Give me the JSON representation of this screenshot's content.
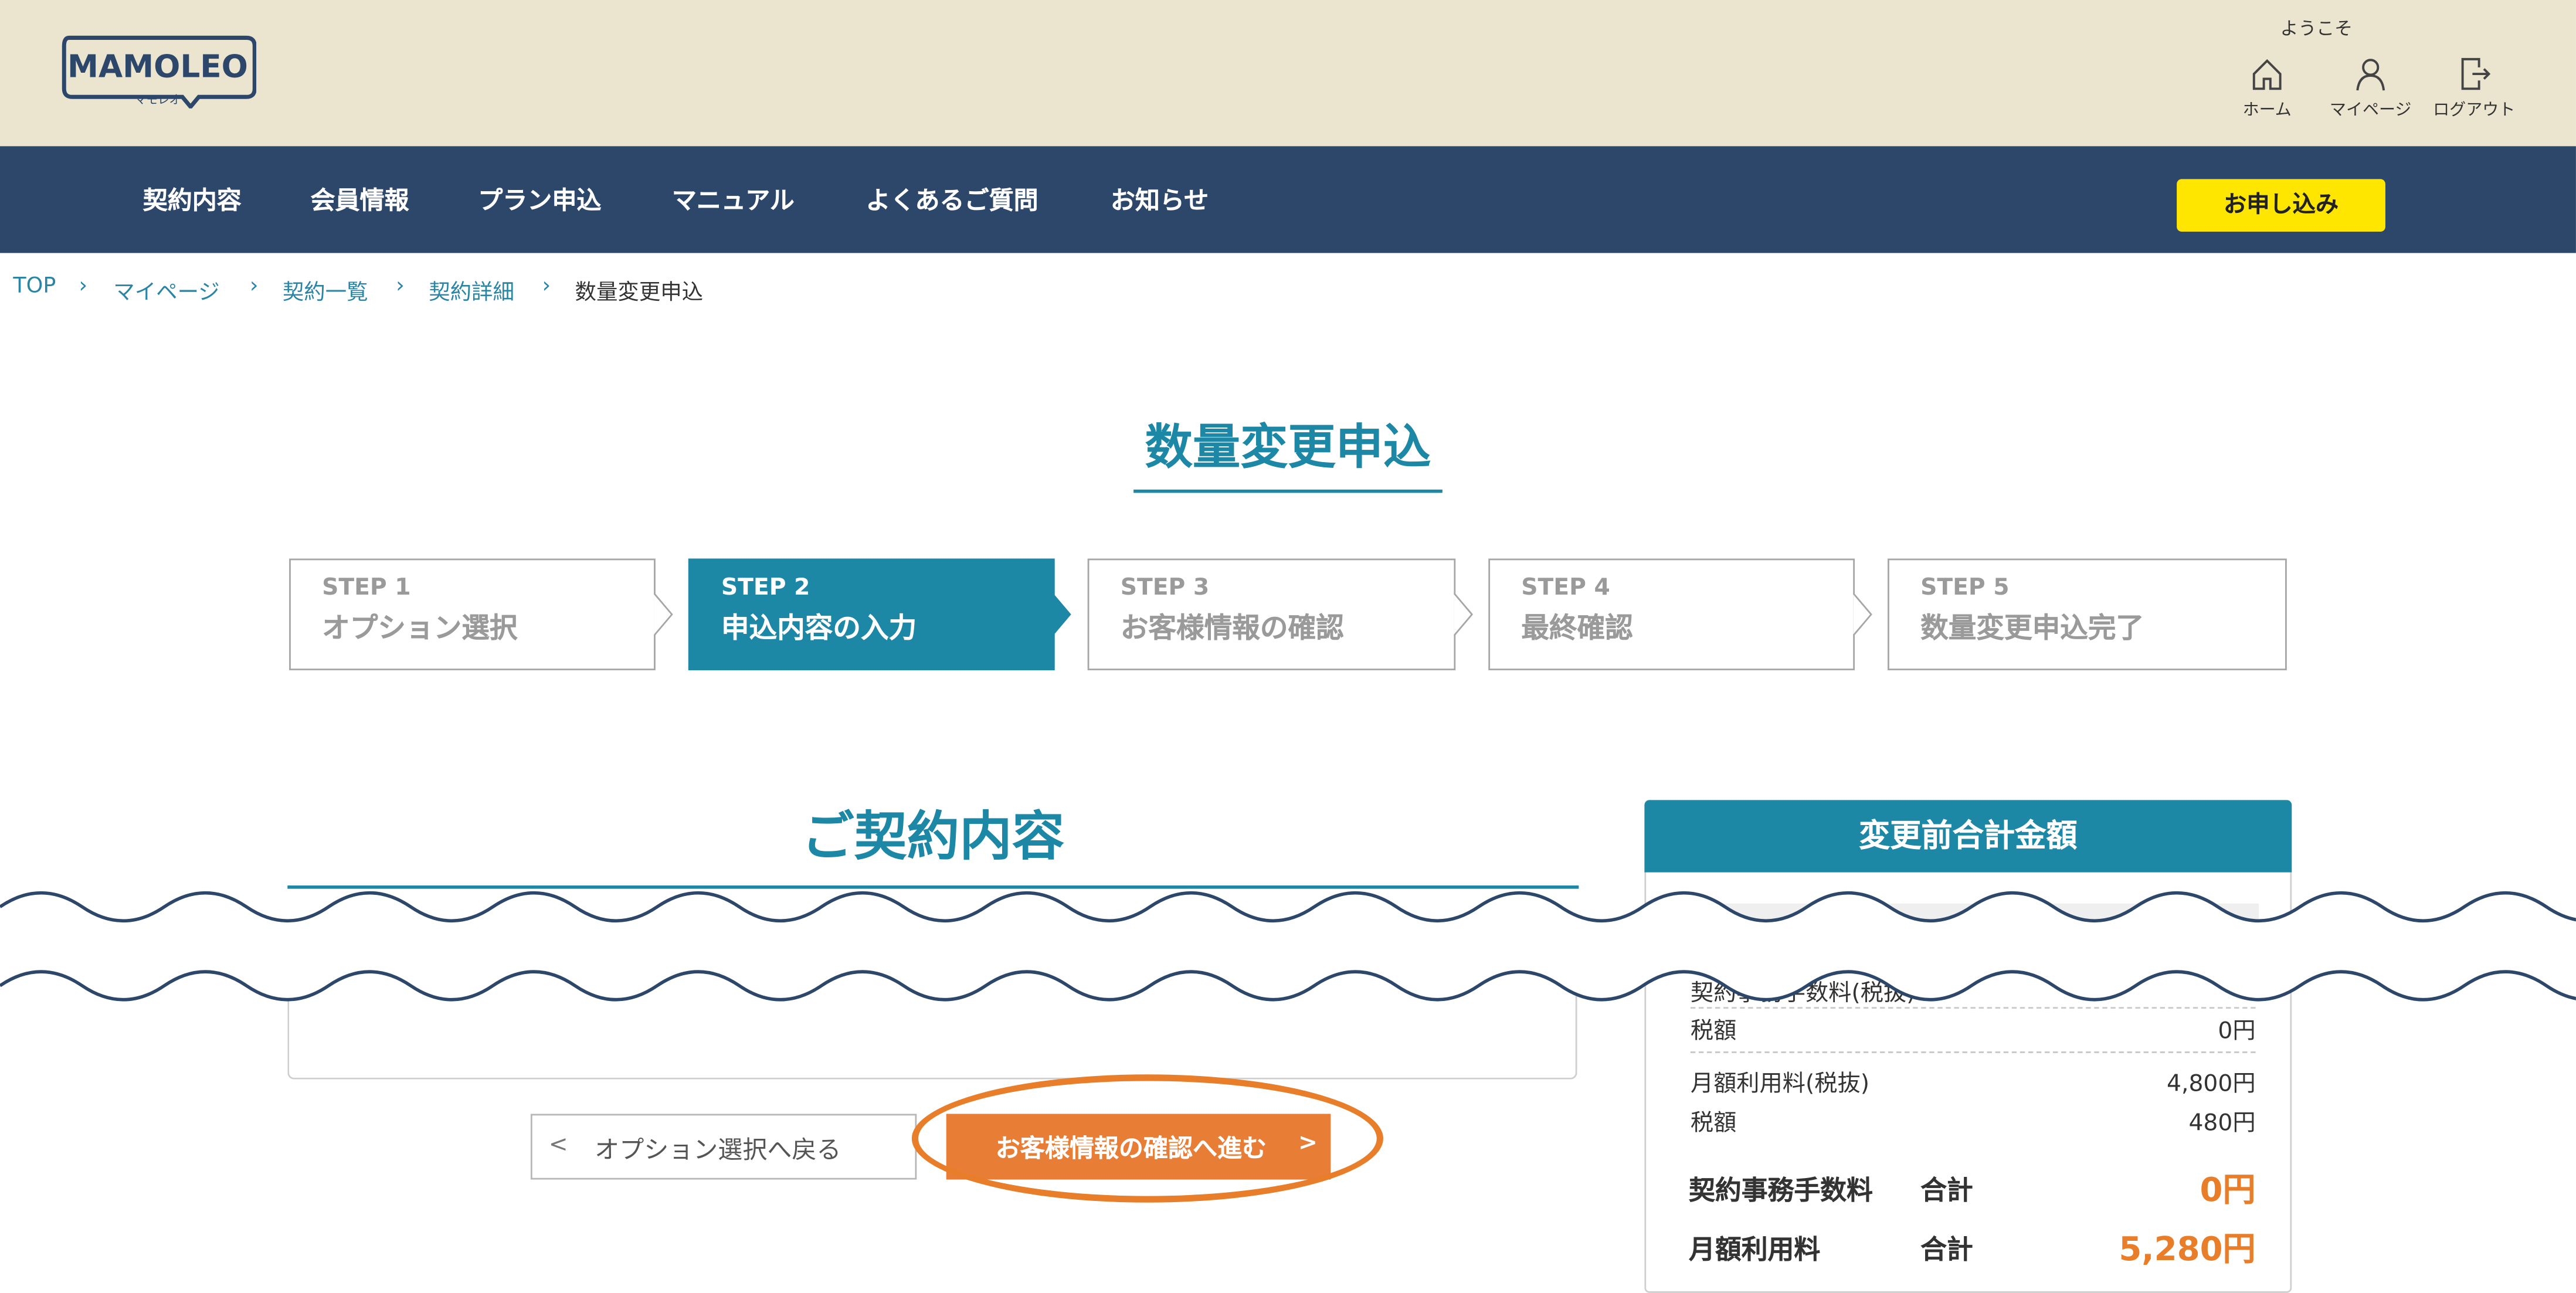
{
  "header": {
    "logo_text": "MAMOLEO",
    "logo_sub": "マモレオ",
    "welcome": "ようこそ",
    "icons": [
      {
        "icon": "home-icon",
        "label": "ホーム"
      },
      {
        "icon": "user-icon",
        "label": "マイページ"
      },
      {
        "icon": "logout-icon",
        "label": "ログアウト"
      }
    ]
  },
  "nav": {
    "items": [
      "契約内容",
      "会員情報",
      "プラン申込",
      "マニュアル",
      "よくあるご質問",
      "お知らせ"
    ],
    "apply_button": "お申し込み"
  },
  "breadcrumb": {
    "items": [
      "TOP",
      "マイページ",
      "契約一覧",
      "契約詳細",
      "数量変更申込"
    ]
  },
  "page": {
    "title": "数量変更申込"
  },
  "steps": [
    {
      "num": "STEP 1",
      "name": "オプション選択",
      "active": false
    },
    {
      "num": "STEP 2",
      "name": "申込内容の入力",
      "active": true
    },
    {
      "num": "STEP 3",
      "name": "お客様情報の確認",
      "active": false
    },
    {
      "num": "STEP 4",
      "name": "最終確認",
      "active": false
    },
    {
      "num": "STEP 5",
      "name": "数量変更申込完了",
      "active": false
    }
  ],
  "section": {
    "title": "ご契約内容"
  },
  "summary": {
    "title": "変更前合計金額",
    "partial_label": "契約事務手数料(税抜)",
    "rows": [
      {
        "label": "税額",
        "value": "0円"
      },
      {
        "label": "月額利用料(税抜)",
        "value": "4,800円"
      },
      {
        "label": "税額",
        "value": "480円"
      }
    ],
    "totals": [
      {
        "label": "契約事務手数料",
        "sub": "合計",
        "value": "0円"
      },
      {
        "label": "月額利用料",
        "sub": "合計",
        "value": "5,280円"
      }
    ]
  },
  "buttons": {
    "back": "オプション選択へ戻る",
    "next": "お客様情報の確認へ進む"
  },
  "colors": {
    "header_bg": "#ebe4cf",
    "nav_bg": "#2d476b",
    "accent_teal": "#1d87a6",
    "apply_yellow": "#ffe600",
    "cta_orange": "#e87d35"
  }
}
